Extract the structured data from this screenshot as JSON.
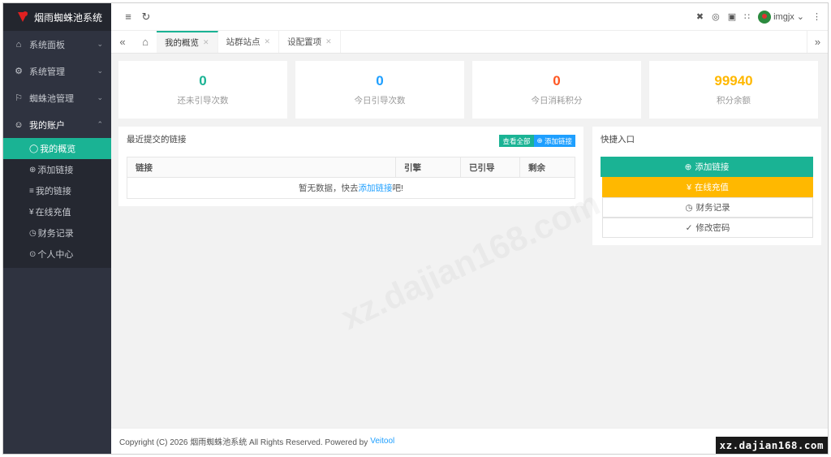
{
  "app": {
    "title": "烟雨蜘蛛池系统"
  },
  "sidebar": {
    "items": [
      {
        "icon": "home-icon",
        "glyph": "⌂",
        "label": "系统面板",
        "chevron": "⌄"
      },
      {
        "icon": "gear-icon",
        "glyph": "⚙",
        "label": "系统管理",
        "chevron": "⌄"
      },
      {
        "icon": "flag-icon",
        "glyph": "⚐",
        "label": "蜘蛛池管理",
        "chevron": "⌄"
      },
      {
        "icon": "user-icon",
        "glyph": "👤",
        "label": "我的账户",
        "chevron": "⌃"
      }
    ],
    "submenu": [
      {
        "glyph": "◯",
        "label": "我的概览"
      },
      {
        "glyph": "⊕",
        "label": "添加链接"
      },
      {
        "glyph": "≡",
        "label": "我的链接"
      },
      {
        "glyph": "¥",
        "label": "在线充值"
      },
      {
        "glyph": "◷",
        "label": "财务记录"
      },
      {
        "glyph": "⊙",
        "label": "个人中心"
      }
    ]
  },
  "header": {
    "username": "imgjx",
    "icons": [
      "menu-fold-icon",
      "refresh-icon",
      "close-circle-icon",
      "globe-icon",
      "lock-icon",
      "fullscreen-icon",
      "more-icon"
    ]
  },
  "tabs": [
    {
      "label": "我的概览"
    },
    {
      "label": "站群站点"
    },
    {
      "label": "设配置项"
    }
  ],
  "stats": [
    {
      "value": "0",
      "label": "还未引导次数",
      "color": "#1ab394"
    },
    {
      "value": "0",
      "label": "今日引导次数",
      "color": "#1e9fff"
    },
    {
      "value": "0",
      "label": "今日消耗积分",
      "color": "#ff5722"
    },
    {
      "value": "99940",
      "label": "积分余额",
      "color": "#ffb800"
    }
  ],
  "links_panel": {
    "title": "最近提交的链接",
    "view_all": "查看全部",
    "add_link": "添加链接",
    "columns": [
      "链接",
      "引擎",
      "已引导",
      "剩余"
    ],
    "empty_prefix": "暂无数据，快去",
    "empty_link": "添加链接",
    "empty_suffix": "吧!"
  },
  "quick_panel": {
    "title": "快捷入口",
    "buttons": [
      {
        "glyph": "⊕",
        "label": "添加链接"
      },
      {
        "glyph": "¥",
        "label": "在线充值"
      },
      {
        "glyph": "◷",
        "label": "财务记录"
      },
      {
        "glyph": "✓",
        "label": "修改密码"
      }
    ]
  },
  "footer": {
    "text": "Copyright (C) 2026 烟雨蜘蛛池系统 All Rights Reserved. Powered by",
    "powered": "Veitool"
  },
  "corner_badge": "xz.dajian168.com",
  "watermark": "xz.dajian168.com"
}
